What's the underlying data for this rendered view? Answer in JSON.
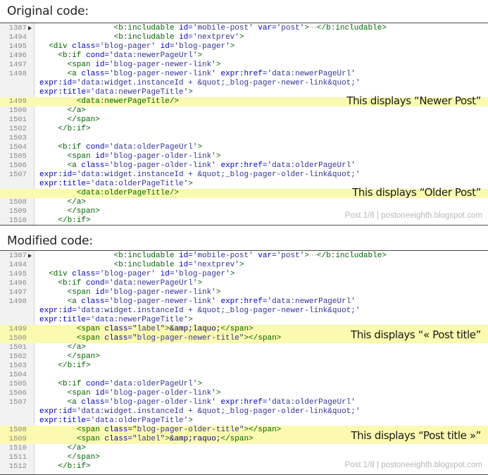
{
  "original": {
    "heading": "Original code:",
    "lines": [
      {
        "ln": "1387",
        "fold": true,
        "hl": false,
        "tokens": [
          [
            "p",
            "                "
          ],
          [
            "tag",
            "<b:includable "
          ],
          [
            "attr",
            "id="
          ],
          [
            "val",
            "'mobile-post'"
          ],
          [
            "p",
            " "
          ],
          [
            "attr",
            "var="
          ],
          [
            "val",
            "'post'"
          ],
          [
            "tag",
            ">"
          ],
          [
            "ell",
            "⋯"
          ],
          [
            "tag",
            "</b:includable>"
          ]
        ]
      },
      {
        "ln": "1494",
        "fold": false,
        "hl": false,
        "tokens": [
          [
            "p",
            "                "
          ],
          [
            "tag",
            "<b:includable "
          ],
          [
            "attr",
            "id="
          ],
          [
            "val",
            "'nextprev'"
          ],
          [
            "tag",
            ">"
          ]
        ]
      },
      {
        "ln": "1495",
        "fold": false,
        "hl": false,
        "tokens": [
          [
            "p",
            "  "
          ],
          [
            "tag",
            "<div "
          ],
          [
            "attr",
            "class="
          ],
          [
            "val",
            "'blog-pager'"
          ],
          [
            "p",
            " "
          ],
          [
            "attr",
            "id="
          ],
          [
            "val",
            "'blog-pager'"
          ],
          [
            "tag",
            ">"
          ]
        ]
      },
      {
        "ln": "1496",
        "fold": false,
        "hl": false,
        "tokens": [
          [
            "p",
            "    "
          ],
          [
            "tag",
            "<b:if "
          ],
          [
            "attr",
            "cond="
          ],
          [
            "val",
            "'data:newerPageUrl'"
          ],
          [
            "tag",
            ">"
          ]
        ]
      },
      {
        "ln": "1497",
        "fold": false,
        "hl": false,
        "tokens": [
          [
            "p",
            "      "
          ],
          [
            "tag",
            "<span "
          ],
          [
            "attr",
            "id="
          ],
          [
            "val",
            "'blog-pager-newer-link'"
          ],
          [
            "tag",
            ">"
          ]
        ]
      },
      {
        "ln": "1498",
        "fold": false,
        "hl": false,
        "tokens": [
          [
            "p",
            "      "
          ],
          [
            "tag",
            "<a "
          ],
          [
            "attr",
            "class="
          ],
          [
            "val",
            "'blog-pager-newer-link'"
          ],
          [
            "p",
            " "
          ],
          [
            "attr",
            "expr:href="
          ],
          [
            "val",
            "'data:newerPageUrl'"
          ]
        ]
      },
      {
        "ln": "",
        "fold": false,
        "hl": false,
        "tokens": [
          [
            "attr",
            "expr:id="
          ],
          [
            "val",
            "'data:widget.instanceId + &quot;_blog-pager-newer-link&quot;'"
          ]
        ]
      },
      {
        "ln": "",
        "fold": false,
        "hl": false,
        "tokens": [
          [
            "attr",
            "expr:title="
          ],
          [
            "val",
            "'data:newerPageTitle'"
          ],
          [
            "tag",
            ">"
          ]
        ]
      },
      {
        "ln": "1499",
        "fold": false,
        "hl": true,
        "tokens": [
          [
            "p",
            "        "
          ],
          [
            "tag",
            "<data:newerPageTitle/>"
          ]
        ]
      },
      {
        "ln": "1500",
        "fold": false,
        "hl": false,
        "tokens": [
          [
            "p",
            "      "
          ],
          [
            "tag",
            "</a>"
          ]
        ]
      },
      {
        "ln": "1501",
        "fold": false,
        "hl": false,
        "tokens": [
          [
            "p",
            "      "
          ],
          [
            "tag",
            "</span>"
          ]
        ]
      },
      {
        "ln": "1502",
        "fold": false,
        "hl": false,
        "tokens": [
          [
            "p",
            "    "
          ],
          [
            "tag",
            "</b:if>"
          ]
        ]
      },
      {
        "ln": "1503",
        "fold": false,
        "hl": false,
        "tokens": []
      },
      {
        "ln": "1504",
        "fold": false,
        "hl": false,
        "tokens": [
          [
            "p",
            "    "
          ],
          [
            "tag",
            "<b:if "
          ],
          [
            "attr",
            "cond="
          ],
          [
            "val",
            "'data:olderPageUrl'"
          ],
          [
            "tag",
            ">"
          ]
        ]
      },
      {
        "ln": "1505",
        "fold": false,
        "hl": false,
        "tokens": [
          [
            "p",
            "      "
          ],
          [
            "tag",
            "<span "
          ],
          [
            "attr",
            "id="
          ],
          [
            "val",
            "'blog-pager-older-link'"
          ],
          [
            "tag",
            ">"
          ]
        ]
      },
      {
        "ln": "1506",
        "fold": false,
        "hl": false,
        "tokens": [
          [
            "p",
            "      "
          ],
          [
            "tag",
            "<a "
          ],
          [
            "attr",
            "class="
          ],
          [
            "val",
            "'blog-pager-older-link'"
          ],
          [
            "p",
            " "
          ],
          [
            "attr",
            "expr:href="
          ],
          [
            "val",
            "'data:olderPageUrl'"
          ]
        ]
      },
      {
        "ln": "1507",
        "fold": false,
        "hl": false,
        "tokens": [
          [
            "attr",
            "expr:id="
          ],
          [
            "val",
            "'data:widget.instanceId + &quot;_blog-pager-older-link&quot;'"
          ]
        ]
      },
      {
        "ln": "",
        "fold": false,
        "hl": false,
        "tokens": [
          [
            "attr",
            "expr:title="
          ],
          [
            "val",
            "'data:olderPageTitle'"
          ],
          [
            "tag",
            ">"
          ]
        ]
      },
      {
        "ln": "",
        "fold": false,
        "hl": true,
        "tokens": [
          [
            "p",
            "        "
          ],
          [
            "tag",
            "<data:olderPageTitle/>"
          ]
        ]
      },
      {
        "ln": "1508",
        "fold": false,
        "hl": false,
        "tokens": [
          [
            "p",
            "      "
          ],
          [
            "tag",
            "</a>"
          ]
        ]
      },
      {
        "ln": "1509",
        "fold": false,
        "hl": false,
        "tokens": [
          [
            "p",
            "      "
          ],
          [
            "tag",
            "</span>"
          ]
        ]
      },
      {
        "ln": "1510",
        "fold": false,
        "hl": false,
        "tokens": [
          [
            "p",
            "    "
          ],
          [
            "tag",
            "</b:if>"
          ]
        ]
      }
    ],
    "annotations": [
      "This displays “Newer Post”",
      "This displays “Older Post”"
    ],
    "watermark": "Post 1/8 | postoneeighth.blogspot.com"
  },
  "modified": {
    "heading": "Modified code:",
    "lines": [
      {
        "ln": "1387",
        "fold": true,
        "hl": false,
        "tokens": [
          [
            "p",
            "                "
          ],
          [
            "tag",
            "<b:includable "
          ],
          [
            "attr",
            "id="
          ],
          [
            "val",
            "'mobile-post'"
          ],
          [
            "p",
            " "
          ],
          [
            "attr",
            "var="
          ],
          [
            "val",
            "'post'"
          ],
          [
            "tag",
            ">"
          ],
          [
            "ell",
            "⋯"
          ],
          [
            "tag",
            "</b:includable>"
          ]
        ]
      },
      {
        "ln": "1494",
        "fold": false,
        "hl": false,
        "tokens": [
          [
            "p",
            "                "
          ],
          [
            "tag",
            "<b:includable "
          ],
          [
            "attr",
            "id="
          ],
          [
            "val",
            "'nextprev'"
          ],
          [
            "tag",
            ">"
          ]
        ]
      },
      {
        "ln": "1495",
        "fold": false,
        "hl": false,
        "tokens": [
          [
            "p",
            "  "
          ],
          [
            "tag",
            "<div "
          ],
          [
            "attr",
            "class="
          ],
          [
            "val",
            "'blog-pager'"
          ],
          [
            "p",
            " "
          ],
          [
            "attr",
            "id="
          ],
          [
            "val",
            "'blog-pager'"
          ],
          [
            "tag",
            ">"
          ]
        ]
      },
      {
        "ln": "1496",
        "fold": false,
        "hl": false,
        "tokens": [
          [
            "p",
            "    "
          ],
          [
            "tag",
            "<b:if "
          ],
          [
            "attr",
            "cond="
          ],
          [
            "val",
            "'data:newerPageUrl'"
          ],
          [
            "tag",
            ">"
          ]
        ]
      },
      {
        "ln": "1497",
        "fold": false,
        "hl": false,
        "tokens": [
          [
            "p",
            "      "
          ],
          [
            "tag",
            "<span "
          ],
          [
            "attr",
            "id="
          ],
          [
            "val",
            "'blog-pager-newer-link'"
          ],
          [
            "tag",
            ">"
          ]
        ]
      },
      {
        "ln": "1498",
        "fold": false,
        "hl": false,
        "tokens": [
          [
            "p",
            "      "
          ],
          [
            "tag",
            "<a "
          ],
          [
            "attr",
            "class="
          ],
          [
            "val",
            "'blog-pager-newer-link'"
          ],
          [
            "p",
            " "
          ],
          [
            "attr",
            "expr:href="
          ],
          [
            "val",
            "'data:newerPageUrl'"
          ]
        ]
      },
      {
        "ln": "",
        "fold": false,
        "hl": false,
        "tokens": [
          [
            "attr",
            "expr:id="
          ],
          [
            "val",
            "'data:widget.instanceId + &quot;_blog-pager-newer-link&quot;'"
          ]
        ]
      },
      {
        "ln": "",
        "fold": false,
        "hl": false,
        "tokens": [
          [
            "attr",
            "expr:title="
          ],
          [
            "val",
            "'data:newerPageTitle'"
          ],
          [
            "tag",
            ">"
          ]
        ]
      },
      {
        "ln": "1499",
        "fold": false,
        "hl": true,
        "tokens": [
          [
            "p",
            "        "
          ],
          [
            "tag",
            "<span "
          ],
          [
            "attr",
            "class="
          ],
          [
            "val",
            "\"label\""
          ],
          [
            "tag",
            ">"
          ],
          [
            "p",
            "&amp;laquo;"
          ],
          [
            "tag",
            "</span>"
          ]
        ]
      },
      {
        "ln": "1500",
        "fold": false,
        "hl": true,
        "tokens": [
          [
            "p",
            "        "
          ],
          [
            "tag",
            "<span "
          ],
          [
            "attr",
            "class="
          ],
          [
            "val",
            "\"blog-pager-newer-title\""
          ],
          [
            "tag",
            "></span>"
          ]
        ]
      },
      {
        "ln": "1501",
        "fold": false,
        "hl": false,
        "tokens": [
          [
            "p",
            "      "
          ],
          [
            "tag",
            "</a>"
          ]
        ]
      },
      {
        "ln": "1502",
        "fold": false,
        "hl": false,
        "tokens": [
          [
            "p",
            "      "
          ],
          [
            "tag",
            "</span>"
          ]
        ]
      },
      {
        "ln": "1503",
        "fold": false,
        "hl": false,
        "tokens": [
          [
            "p",
            "    "
          ],
          [
            "tag",
            "</b:if>"
          ]
        ]
      },
      {
        "ln": "1504",
        "fold": false,
        "hl": false,
        "tokens": []
      },
      {
        "ln": "1505",
        "fold": false,
        "hl": false,
        "tokens": [
          [
            "p",
            "    "
          ],
          [
            "tag",
            "<b:if "
          ],
          [
            "attr",
            "cond="
          ],
          [
            "val",
            "'data:olderPageUrl'"
          ],
          [
            "tag",
            ">"
          ]
        ]
      },
      {
        "ln": "1506",
        "fold": false,
        "hl": false,
        "tokens": [
          [
            "p",
            "      "
          ],
          [
            "tag",
            "<span "
          ],
          [
            "attr",
            "id="
          ],
          [
            "val",
            "'blog-pager-older-link'"
          ],
          [
            "tag",
            ">"
          ]
        ]
      },
      {
        "ln": "1507",
        "fold": false,
        "hl": false,
        "tokens": [
          [
            "p",
            "      "
          ],
          [
            "tag",
            "<a "
          ],
          [
            "attr",
            "class="
          ],
          [
            "val",
            "'blog-pager-older-link'"
          ],
          [
            "p",
            " "
          ],
          [
            "attr",
            "expr:href="
          ],
          [
            "val",
            "'data:olderPageUrl'"
          ]
        ]
      },
      {
        "ln": "",
        "fold": false,
        "hl": false,
        "tokens": [
          [
            "attr",
            "expr:id="
          ],
          [
            "val",
            "'data:widget.instanceId + &quot;_blog-pager-older-link&quot;'"
          ]
        ]
      },
      {
        "ln": "",
        "fold": false,
        "hl": false,
        "tokens": [
          [
            "attr",
            "expr:title="
          ],
          [
            "val",
            "'data:olderPageTitle'"
          ],
          [
            "tag",
            ">"
          ]
        ]
      },
      {
        "ln": "1508",
        "fold": false,
        "hl": true,
        "tokens": [
          [
            "p",
            "        "
          ],
          [
            "tag",
            "<span "
          ],
          [
            "attr",
            "class="
          ],
          [
            "val",
            "\"blog-pager-older-title\""
          ],
          [
            "tag",
            "></span>"
          ]
        ]
      },
      {
        "ln": "1509",
        "fold": false,
        "hl": true,
        "tokens": [
          [
            "p",
            "        "
          ],
          [
            "tag",
            "<span "
          ],
          [
            "attr",
            "class="
          ],
          [
            "val",
            "\"label\""
          ],
          [
            "tag",
            ">"
          ],
          [
            "p",
            "&amp;raquo;"
          ],
          [
            "tag",
            "</span>"
          ]
        ]
      },
      {
        "ln": "1510",
        "fold": false,
        "hl": false,
        "tokens": [
          [
            "p",
            "      "
          ],
          [
            "tag",
            "</a>"
          ]
        ]
      },
      {
        "ln": "1511",
        "fold": false,
        "hl": false,
        "tokens": [
          [
            "p",
            "      "
          ],
          [
            "tag",
            "</span>"
          ]
        ]
      },
      {
        "ln": "1512",
        "fold": false,
        "hl": false,
        "tokens": [
          [
            "p",
            "    "
          ],
          [
            "tag",
            "</b:if>"
          ]
        ]
      }
    ],
    "annotations": [
      "This displays “« Post title”",
      "This displays “Post title »”"
    ],
    "watermark": "Post 1/8 | postoneeighth.blogspot.com"
  },
  "colors": {
    "highlight": "#fafab0",
    "tag": "#006400",
    "attribute": "#0000cc",
    "value": "#333399",
    "plain": "#000080",
    "line_number": "#8a8a8a"
  }
}
